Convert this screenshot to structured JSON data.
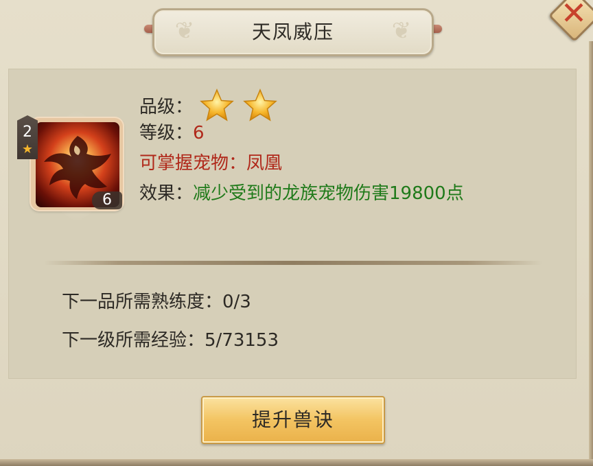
{
  "dialog": {
    "title": "天凤威压",
    "close_icon": "close-x-icon"
  },
  "pet": {
    "rank": "2",
    "count": "6",
    "icon": "phoenix-icon"
  },
  "info": {
    "grade_label": "品级：",
    "grade_stars": 2,
    "level_label": "等级：",
    "level_value": "6",
    "pet_line": "可掌握宠物：凤凰",
    "effect_label": "效果：",
    "effect_value": "减少受到的龙族宠物伤害19800点"
  },
  "requirements": {
    "next_grade": "下一品所需熟练度：0/3",
    "next_level": "下一级所需经验：5/73153"
  },
  "upgrade_button": "提升兽诀",
  "colors": {
    "red_text": "#b0281a",
    "green_text": "#1f7a1a",
    "button_gold": "#f3c462"
  }
}
